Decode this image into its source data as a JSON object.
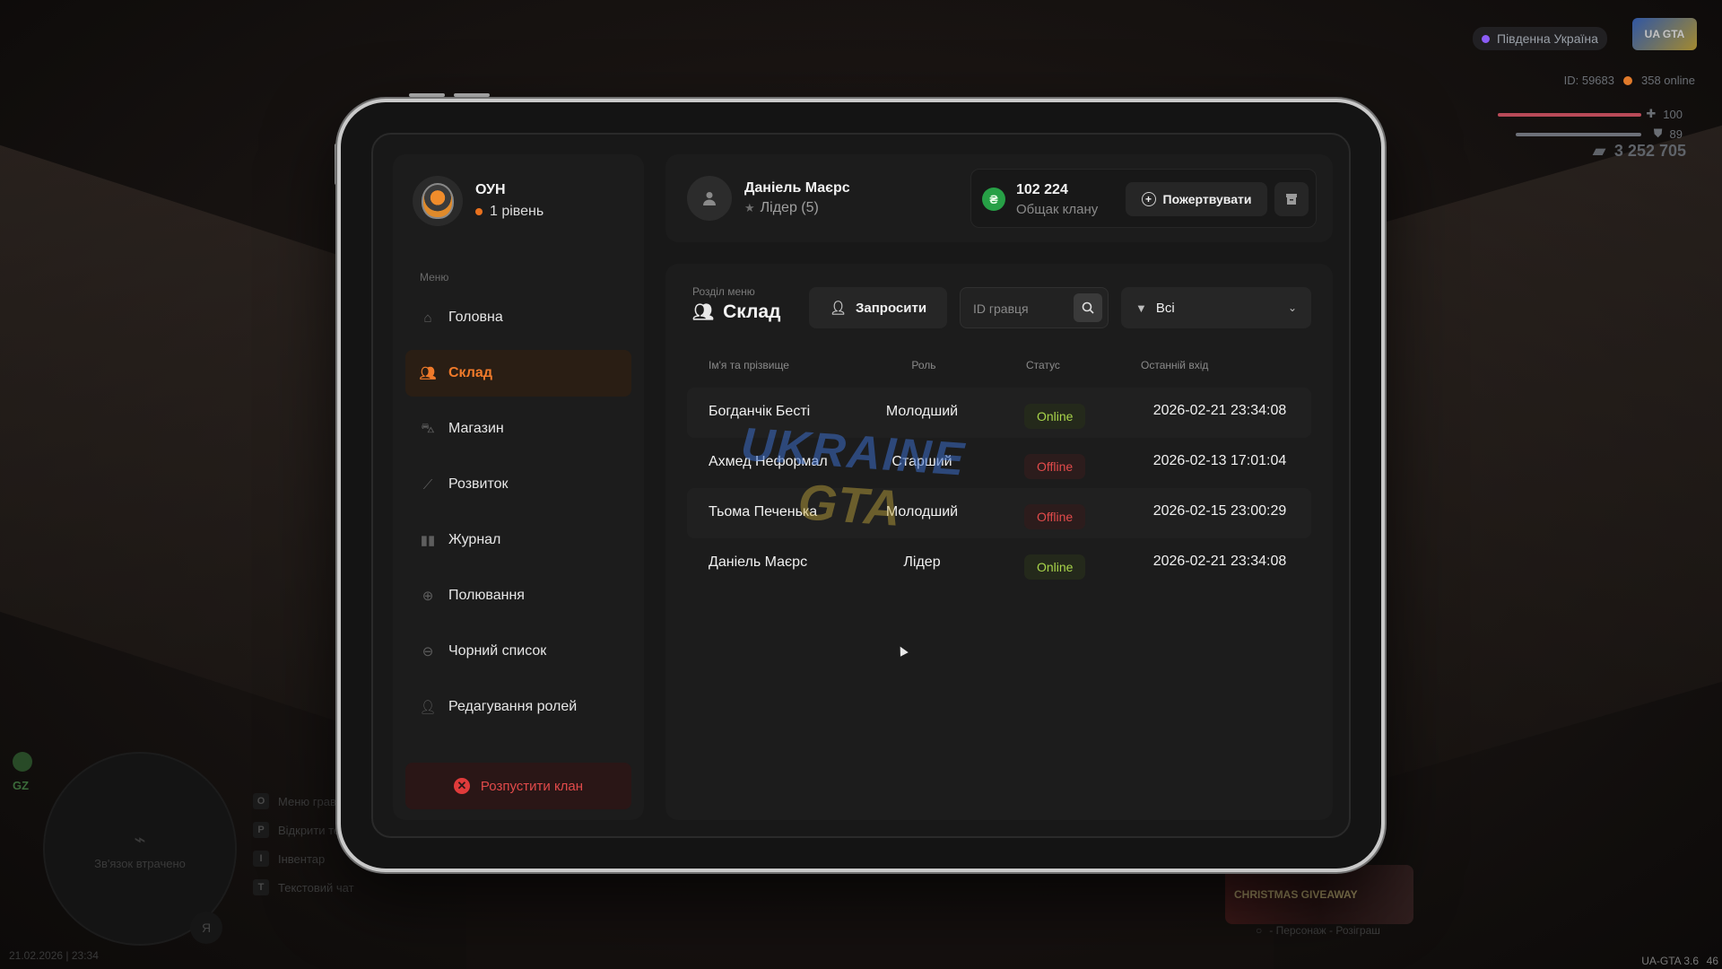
{
  "hud": {
    "server_name": "Південна Україна",
    "player_id": "ID: 59683",
    "online": "358 online",
    "health": "100",
    "armor": "89",
    "money": "3 252 705",
    "minimap_text": "Зв'язок втрачено",
    "gz_label": "GZ",
    "hints": [
      {
        "key": "O",
        "label": "Меню гравця"
      },
      {
        "key": "P",
        "label": "Відкрити телефон"
      },
      {
        "key": "I",
        "label": "Інвентар"
      },
      {
        "key": "T",
        "label": "Текстовий чат"
      }
    ],
    "mic_key": "Я",
    "datetime": "21.02.2026 | 23:34",
    "version": "UA-GTA 3.6",
    "fps": "46",
    "promo_title": "CHRISTMAS GIVEAWAY",
    "promo_caption": "- Персонаж - Розіграш",
    "watermark_line1": "UKRAINE",
    "watermark_line2": "GTA"
  },
  "clan": {
    "name": "ОУН",
    "level": "1 рівень"
  },
  "sidebar": {
    "menu_caption": "Меню",
    "items": [
      {
        "label": "Головна",
        "icon": "home-icon",
        "active": false
      },
      {
        "label": "Склад",
        "icon": "members-icon",
        "active": true
      },
      {
        "label": "Магазин",
        "icon": "basket-icon",
        "active": false
      },
      {
        "label": "Розвиток",
        "icon": "chart-icon",
        "active": false
      },
      {
        "label": "Журнал",
        "icon": "book-icon",
        "active": false
      },
      {
        "label": "Полювання",
        "icon": "crosshair-icon",
        "active": false
      },
      {
        "label": "Чорний список",
        "icon": "block-icon",
        "active": false
      },
      {
        "label": "Редагування ролей",
        "icon": "user-gear-icon",
        "active": false
      }
    ],
    "disband_label": "Розпустити клан"
  },
  "user": {
    "name": "Даніель Маєрс",
    "role": "Лідер (5)"
  },
  "bank": {
    "amount": "102 224",
    "label": "Общак клану",
    "currency_symbol": "₴",
    "donate_label": "Пожертвувати"
  },
  "section": {
    "caption": "Розділ меню",
    "title": "Склад",
    "invite_label": "Запросити",
    "search_placeholder": "ID гравця",
    "filter_value": "Всі"
  },
  "table": {
    "headers": {
      "name": "Ім'я та прізвище",
      "role": "Роль",
      "status": "Статус",
      "last_login": "Останній вхід"
    },
    "rows": [
      {
        "name": "Богданчік Бесті",
        "role": "Молодший",
        "status": "Online",
        "last_login": "2026-02-21 23:34:08"
      },
      {
        "name": "Ахмед Неформал",
        "role": "Старший",
        "status": "Offline",
        "last_login": "2026-02-13 17:01:04"
      },
      {
        "name": "Тьома Печенька",
        "role": "Молодший",
        "status": "Offline",
        "last_login": "2026-02-15 23:00:29"
      },
      {
        "name": "Даніель Маєрс",
        "role": "Лідер",
        "status": "Online",
        "last_login": "2026-02-21 23:34:08"
      }
    ]
  },
  "colors": {
    "accent": "#f07a2a",
    "online": "#a8d44a",
    "offline": "#e24b4b",
    "money_green": "#27a046"
  }
}
